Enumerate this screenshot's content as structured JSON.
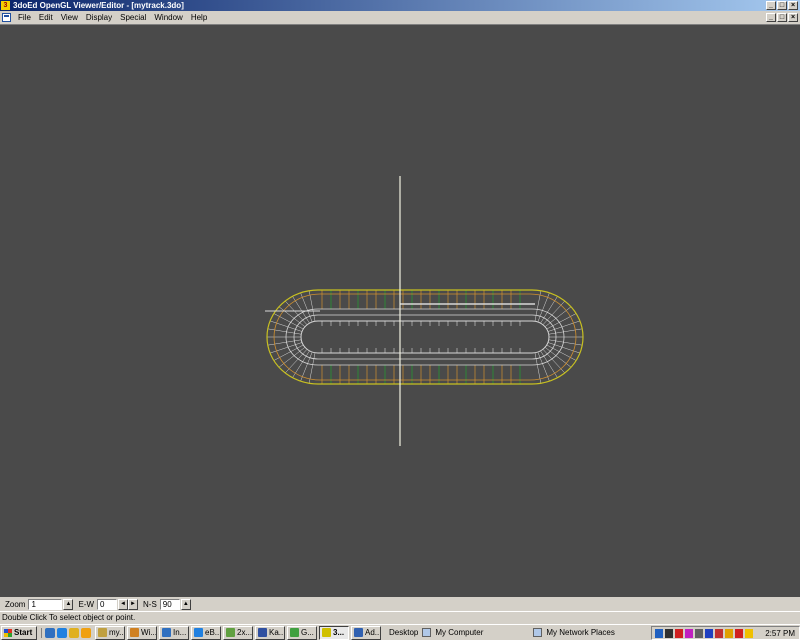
{
  "window": {
    "app_icon_label": "3",
    "title": "3doEd OpenGL Viewer/Editor - [mytrack.3do]",
    "buttons": {
      "minimize": "_",
      "maximize": "□",
      "close": "×"
    }
  },
  "menubar": {
    "items": [
      "File",
      "Edit",
      "View",
      "Display",
      "Special",
      "Window",
      "Help"
    ],
    "mdi_buttons": {
      "minimize": "_",
      "restore": "□",
      "close": "×"
    }
  },
  "viewport": {
    "background": "#4a4a4a",
    "axis_color": "#f0f0e0",
    "outer_ring_color": "#c8c020",
    "track_edge_color": "#d09030",
    "inner_ring_color": "#d8d8d8",
    "post_color": "#20a030"
  },
  "controls": {
    "zoom": {
      "label": "Zoom",
      "value": "1"
    },
    "ew": {
      "label": "E-W",
      "value": "0"
    },
    "ns": {
      "label": "N-S",
      "value": "90"
    }
  },
  "status": {
    "text": "Double Click To select object or point."
  },
  "taskbar": {
    "start_label": "Start",
    "quick_launch_icons": [
      "desktop-icon",
      "ie-icon",
      "outlook-icon",
      "media-icon"
    ],
    "quick_launch_colors": [
      "#3070c0",
      "#2080e0",
      "#e0b020",
      "#f0a010"
    ],
    "tasks": [
      {
        "label": "my...",
        "color": "#c0a040",
        "active": false
      },
      {
        "label": "Wi...",
        "color": "#d08020",
        "active": false
      },
      {
        "label": "In...",
        "color": "#3070c0",
        "active": false
      },
      {
        "label": "eB...",
        "color": "#2080e0",
        "active": false
      },
      {
        "label": "2x...",
        "color": "#60a040",
        "active": false
      },
      {
        "label": "Ka...",
        "color": "#3050a0",
        "active": false
      },
      {
        "label": "G...",
        "color": "#40a040",
        "active": false
      },
      {
        "label": "3...",
        "color": "#d0c000",
        "active": true
      },
      {
        "label": "Ad...",
        "color": "#3060b0",
        "active": false
      }
    ],
    "desktop_label": "Desktop",
    "my_computer_label": "My Computer",
    "network_places_label": "My Network Places",
    "tray_icons": [
      "#2060c0",
      "#303030",
      "#d02020",
      "#c020c0",
      "#606060",
      "#2040c0",
      "#c03030",
      "#e0a000",
      "#d02020",
      "#f0c000"
    ],
    "clock": "2:57 PM"
  }
}
